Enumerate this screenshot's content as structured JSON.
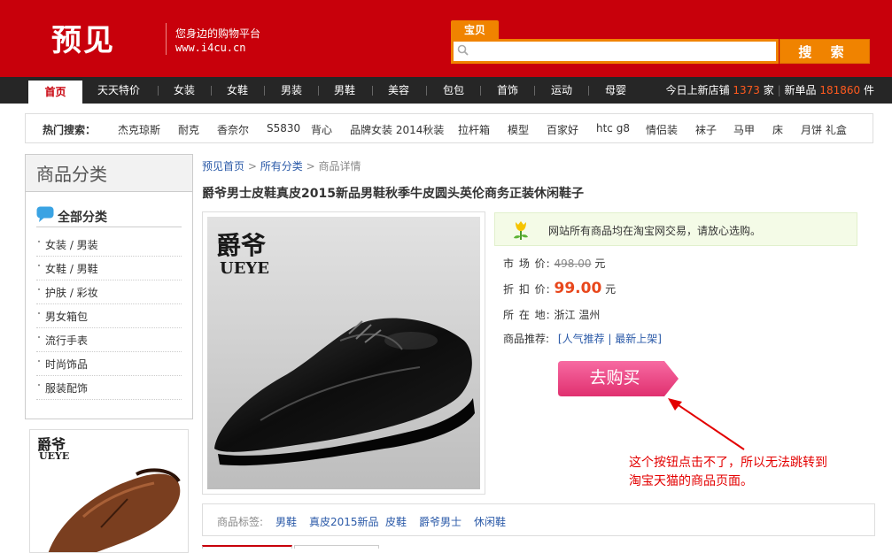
{
  "header": {
    "logo": "预见",
    "slogan": "您身边的购物平台",
    "url": "www.i4cu.cn",
    "search_tab": "宝贝",
    "search_placeholder": "",
    "search_button": "搜 索",
    "brand_color": "#c8000b",
    "accent_color": "#f08300"
  },
  "nav": {
    "items": [
      "首页",
      "天天特价",
      "女装",
      "女鞋",
      "男装",
      "男鞋",
      "美容",
      "包包",
      "首饰",
      "运动",
      "母婴"
    ],
    "active": "首页",
    "stats_prefix_1": "今日上新店铺",
    "shops_new": "1373",
    "stats_unit_1": "家",
    "stats_prefix_2": "新单品",
    "items_new": "181860",
    "stats_unit_2": "件"
  },
  "hot_search": {
    "label": "热门搜索：",
    "items": [
      "杰克琼斯",
      "耐克",
      "香奈尔",
      "S5830",
      "背心",
      "品牌女装 2014秋装",
      "拉杆箱",
      "模型",
      "百家好",
      "htc g8",
      "情侣装",
      "袜子",
      "马甲",
      "床",
      "月饼 礼盒"
    ]
  },
  "sidebar": {
    "title": "商品分类",
    "all_label": "全部分类",
    "items": [
      "女装 / 男装",
      "女鞋 / 男鞋",
      "护肤 / 彩妆",
      "男女箱包",
      "流行手表",
      "时尚饰品",
      "服装配饰"
    ]
  },
  "breadcrumb": {
    "home": "预见首页",
    "sep": ">",
    "category": "所有分类",
    "current": "商品详情"
  },
  "product": {
    "title": "爵爷男士皮鞋真皮2015新品男鞋秋季牛皮圆头英伦商务正装休闲鞋子",
    "brand_cn": "爵爷",
    "brand_en": "UEYE",
    "notice": "网站所有商品均在淘宝网交易，请放心选购。",
    "market_price_label": "市 场 价:",
    "market_price": "498.00",
    "unit": "元",
    "discount_price_label": "折 扣 价:",
    "discount_price": "99.00",
    "location_label": "所 在 地:",
    "location": "浙江 温州",
    "recommend_label": "商品推荐:",
    "recommend_open": "[",
    "recommend_link_1": "人气推荐",
    "recommend_sep": "|",
    "recommend_link_2": "最新上架",
    "recommend_close": "]",
    "buy_button": "去购买",
    "buy_button_color": "#e83e7f",
    "price_color": "#e8471c"
  },
  "annotation": {
    "line1": "这个按钮点击不了，所以无法跳转到",
    "line2": "淘宝天猫的商品页面。",
    "color": "#e30000"
  },
  "tags": {
    "label": "商品标签:",
    "items": [
      "男鞋",
      "真皮2015新品",
      "皮鞋",
      "爵爷男士",
      "休闲鞋"
    ]
  }
}
